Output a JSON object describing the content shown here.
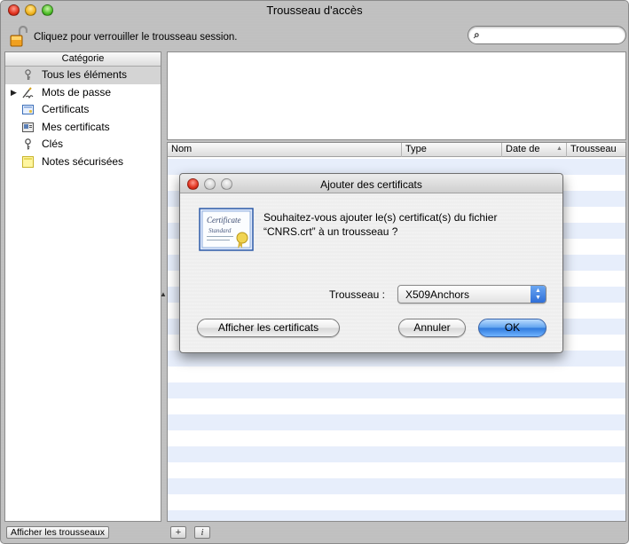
{
  "window": {
    "title": "Trousseau d'accès",
    "lock_text": "Cliquez pour verrouiller le trousseau session.",
    "search_value": ""
  },
  "sidebar": {
    "header": "Catégorie",
    "items": [
      {
        "label": "Tous les éléments",
        "icon": "all-items-icon"
      },
      {
        "label": "Mots de passe",
        "icon": "password-icon"
      },
      {
        "label": "Certificats",
        "icon": "certificate-icon"
      },
      {
        "label": "Mes certificats",
        "icon": "my-certificates-icon"
      },
      {
        "label": "Clés",
        "icon": "key-icon"
      },
      {
        "label": "Notes sécurisées",
        "icon": "secure-note-icon"
      }
    ],
    "show_keychains_label": "Afficher les trousseaux"
  },
  "table": {
    "columns": [
      "Nom",
      "Type",
      "Date de",
      "Trousseau"
    ]
  },
  "bottom": {
    "add_label": "+",
    "info_label": "i"
  },
  "dialog": {
    "title": "Ajouter des certificats",
    "message": "Souhaitez-vous ajouter le(s) certificat(s) du fichier “CNRS.crt” à un trousseau ?",
    "keychain_label": "Trousseau :",
    "keychain_value": "X509Anchors",
    "show_certs_label": "Afficher les certificats",
    "cancel_label": "Annuler",
    "ok_label": "OK",
    "cert_icon_line1": "Certificate",
    "cert_icon_line2": "Standard"
  }
}
